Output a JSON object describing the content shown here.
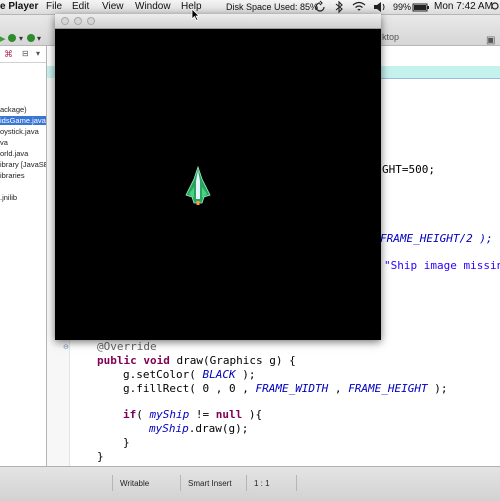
{
  "menubar": {
    "app_name": "e Player",
    "items": [
      "File",
      "Edit",
      "View",
      "Window",
      "Help"
    ],
    "disk_space": "Disk Space Used: 85%",
    "battery": "99%",
    "clock": "Mon 7:42 AM"
  },
  "ide": {
    "desktop_label": "ktop"
  },
  "project_tree": {
    "items": [
      {
        "label": "ackage)",
        "selected": false
      },
      {
        "label": "idsGame.java",
        "selected": true
      },
      {
        "label": "oystick.java",
        "selected": false
      },
      {
        "label": "va",
        "selected": false
      },
      {
        "label": "orld.java",
        "selected": false
      },
      {
        "label": "ibrary [JavaSE",
        "selected": false
      },
      {
        "label": "ibraries",
        "selected": false
      },
      {
        "label": ".jnilib",
        "selected": false
      }
    ]
  },
  "code": {
    "frame_height_line": "GHT=500;",
    "frame_height_half": "FRAME_HEIGHT/2 );",
    "ship_missing_text": "\"Ship image missin",
    "override": "@Override",
    "draw_sig": {
      "kw1": "public",
      "kw2": "void",
      "rest": " draw(Graphics g) {"
    },
    "setcolor": {
      "pre": "g.setColor( ",
      "const": "BLACK",
      "post": " );"
    },
    "fillrect": {
      "pre": "g.fillRect( 0 , 0 , ",
      "c1": "FRAME_WIDTH",
      "mid": " , ",
      "c2": "FRAME_HEIGHT",
      "post": " );"
    },
    "if_line": {
      "kw": "if",
      "a": "( ",
      "field": "myShip",
      "b": " != ",
      "kw2": "null",
      "c": " ){"
    },
    "ship_draw": {
      "field": "myShip",
      "rest": ".draw(g);"
    },
    "close_inner": "}",
    "close_outer": "}"
  },
  "statusbar": {
    "writable": "Writable",
    "insert_mode": "Smart Insert",
    "position": "1 : 1"
  },
  "colors": {
    "keyword": "#7f0055",
    "constant": "#0000c0",
    "ship_body": "#2fbf6b",
    "selection": "#3875d7"
  },
  "icons": [
    "apple-menu",
    "sync-icon",
    "bluetooth-icon",
    "wifi-icon",
    "volume-icon",
    "battery-icon",
    "search-icon",
    "list-icon"
  ]
}
